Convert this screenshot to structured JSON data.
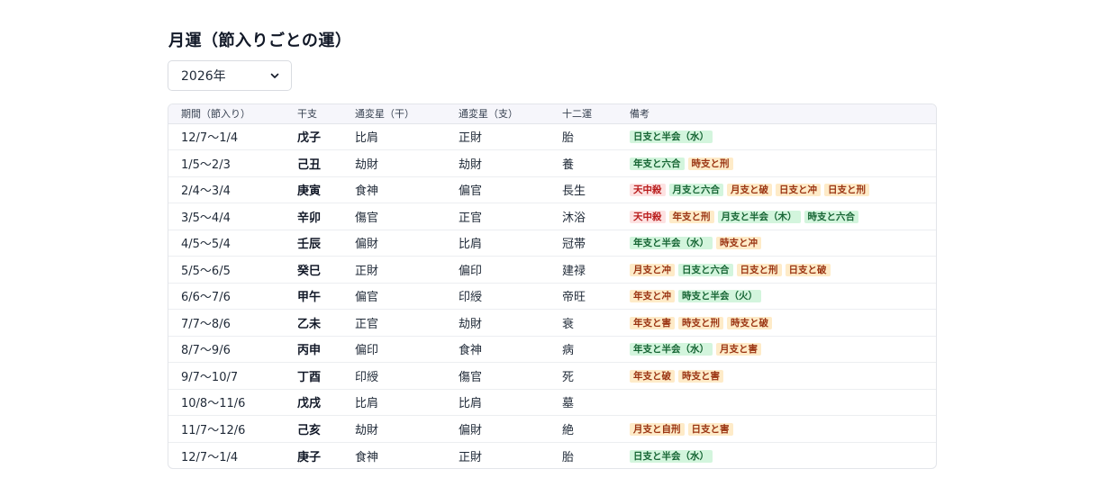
{
  "page": {
    "title": "月運（節入りごとの運）"
  },
  "year_select": {
    "value": "2026年"
  },
  "table": {
    "headers": [
      "期間（節入り）",
      "干支",
      "通変星（干）",
      "通変星（支）",
      "十二運",
      "備考"
    ],
    "rows": [
      {
        "period": "12/7〜1/4",
        "kanshi": "戊子",
        "tsuhen_kan": "比肩",
        "tsuhen_shi": "正財",
        "juniun": "胎",
        "notes": [
          {
            "label": "日支と半会（水）",
            "kind": "green"
          }
        ]
      },
      {
        "period": "1/5〜2/3",
        "kanshi": "己丑",
        "tsuhen_kan": "劫財",
        "tsuhen_shi": "劫財",
        "juniun": "養",
        "notes": [
          {
            "label": "年支と六合",
            "kind": "green"
          },
          {
            "label": "時支と刑",
            "kind": "orange"
          }
        ]
      },
      {
        "period": "2/4〜3/4",
        "kanshi": "庚寅",
        "tsuhen_kan": "食神",
        "tsuhen_shi": "偏官",
        "juniun": "長生",
        "notes": [
          {
            "label": "天中殺",
            "kind": "red"
          },
          {
            "label": "月支と六合",
            "kind": "green"
          },
          {
            "label": "月支と破",
            "kind": "orange"
          },
          {
            "label": "日支と冲",
            "kind": "orange"
          },
          {
            "label": "日支と刑",
            "kind": "orange"
          }
        ]
      },
      {
        "period": "3/5〜4/4",
        "kanshi": "辛卯",
        "tsuhen_kan": "傷官",
        "tsuhen_shi": "正官",
        "juniun": "沐浴",
        "notes": [
          {
            "label": "天中殺",
            "kind": "red"
          },
          {
            "label": "年支と刑",
            "kind": "orange"
          },
          {
            "label": "月支と半会（木）",
            "kind": "green"
          },
          {
            "label": "時支と六合",
            "kind": "green"
          }
        ]
      },
      {
        "period": "4/5〜5/4",
        "kanshi": "壬辰",
        "tsuhen_kan": "偏財",
        "tsuhen_shi": "比肩",
        "juniun": "冠帯",
        "notes": [
          {
            "label": "年支と半会（水）",
            "kind": "green"
          },
          {
            "label": "時支と冲",
            "kind": "orange"
          }
        ]
      },
      {
        "period": "5/5〜6/5",
        "kanshi": "癸巳",
        "tsuhen_kan": "正財",
        "tsuhen_shi": "偏印",
        "juniun": "建禄",
        "notes": [
          {
            "label": "月支と冲",
            "kind": "orange"
          },
          {
            "label": "日支と六合",
            "kind": "green"
          },
          {
            "label": "日支と刑",
            "kind": "orange"
          },
          {
            "label": "日支と破",
            "kind": "orange"
          }
        ]
      },
      {
        "period": "6/6〜7/6",
        "kanshi": "甲午",
        "tsuhen_kan": "偏官",
        "tsuhen_shi": "印綬",
        "juniun": "帝旺",
        "notes": [
          {
            "label": "年支と冲",
            "kind": "orange"
          },
          {
            "label": "時支と半会（火）",
            "kind": "green"
          }
        ]
      },
      {
        "period": "7/7〜8/6",
        "kanshi": "乙未",
        "tsuhen_kan": "正官",
        "tsuhen_shi": "劫財",
        "juniun": "衰",
        "notes": [
          {
            "label": "年支と害",
            "kind": "orange"
          },
          {
            "label": "時支と刑",
            "kind": "orange"
          },
          {
            "label": "時支と破",
            "kind": "orange"
          }
        ]
      },
      {
        "period": "8/7〜9/6",
        "kanshi": "丙申",
        "tsuhen_kan": "偏印",
        "tsuhen_shi": "食神",
        "juniun": "病",
        "notes": [
          {
            "label": "年支と半会（水）",
            "kind": "green"
          },
          {
            "label": "月支と害",
            "kind": "orange"
          }
        ]
      },
      {
        "period": "9/7〜10/7",
        "kanshi": "丁酉",
        "tsuhen_kan": "印綬",
        "tsuhen_shi": "傷官",
        "juniun": "死",
        "notes": [
          {
            "label": "年支と破",
            "kind": "orange"
          },
          {
            "label": "時支と害",
            "kind": "orange"
          }
        ]
      },
      {
        "period": "10/8〜11/6",
        "kanshi": "戊戌",
        "tsuhen_kan": "比肩",
        "tsuhen_shi": "比肩",
        "juniun": "墓",
        "notes": []
      },
      {
        "period": "11/7〜12/6",
        "kanshi": "己亥",
        "tsuhen_kan": "劫財",
        "tsuhen_shi": "偏財",
        "juniun": "絶",
        "notes": [
          {
            "label": "月支と自刑",
            "kind": "orange"
          },
          {
            "label": "日支と害",
            "kind": "orange"
          }
        ]
      },
      {
        "period": "12/7〜1/4",
        "kanshi": "庚子",
        "tsuhen_kan": "食神",
        "tsuhen_shi": "正財",
        "juniun": "胎",
        "notes": [
          {
            "label": "日支と半会（水）",
            "kind": "green"
          }
        ]
      }
    ]
  },
  "colors": {
    "badge_red_bg": "#fde2e2",
    "badge_red_text": "#b91c1c",
    "badge_green_bg": "#d3f5dd",
    "badge_green_text": "#166534",
    "badge_orange_bg": "#feebc8",
    "badge_orange_text": "#9a3412"
  },
  "icons": {
    "select_chevron": "chevron-down-icon"
  }
}
